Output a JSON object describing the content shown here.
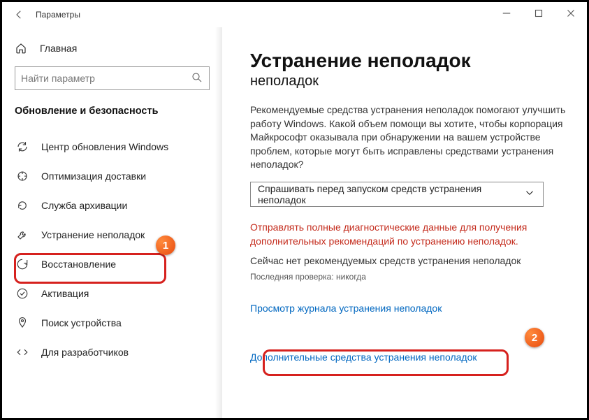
{
  "titlebar": {
    "title": "Параметры"
  },
  "sidebar": {
    "home": "Главная",
    "search_placeholder": "Найти параметр",
    "section": "Обновление и безопасность",
    "items": [
      {
        "label": "Центр обновления Windows"
      },
      {
        "label": "Оптимизация доставки"
      },
      {
        "label": "Служба архивации"
      },
      {
        "label": "Устранение неполадок"
      },
      {
        "label": "Восстановление"
      },
      {
        "label": "Активация"
      },
      {
        "label": "Поиск устройства"
      },
      {
        "label": "Для разработчиков"
      }
    ]
  },
  "main": {
    "heading": "Устранение неполадок",
    "subheading": "неполадок",
    "paragraph": "Рекомендуемые средства устранения неполадок помогают улучшить работу Windows. Какой объем помощи вы хотите, чтобы корпорация Майкрософт оказывала при обнаружении на вашем устройстве проблем, которые могут быть исправлены средствами устранения неполадок?",
    "dropdown_value": "Спрашивать перед запуском средств устранения неполадок",
    "warning": "Отправлять полные диагностические данные для получения дополнительных рекомендаций по устранению неполадок.",
    "status_line": "Сейчас нет рекомендуемых средств устранения неполадок",
    "last_check": "Последняя проверка: никогда",
    "link_history": "Просмотр журнала устранения неполадок",
    "link_more": "Дополнительные средства устранения неполадок"
  },
  "annotations": {
    "badge1": "1",
    "badge2": "2"
  }
}
